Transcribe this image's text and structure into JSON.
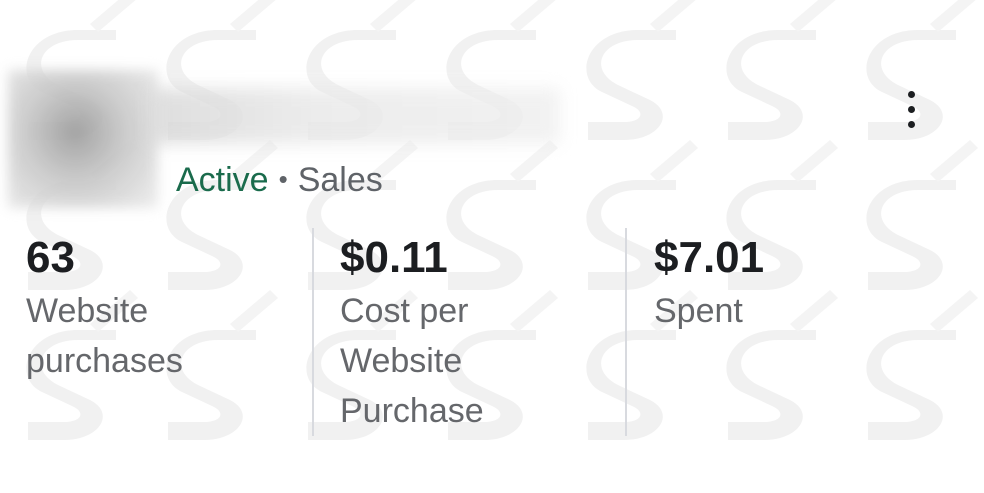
{
  "campaign": {
    "status": "Active",
    "separator": "•",
    "objective": "Sales"
  },
  "more_menu": {
    "icon": "more-vertical-icon"
  },
  "metrics": [
    {
      "value": "63",
      "label_lines": [
        "Website",
        "purchases"
      ]
    },
    {
      "value": "$0.11",
      "label_lines": [
        "Cost per",
        "Website",
        "Purchase"
      ]
    },
    {
      "value": "$7.01",
      "label_lines": [
        "Spent"
      ]
    }
  ],
  "colors": {
    "status_active": "#1a6b4c",
    "text_primary": "#1c1e21",
    "text_secondary": "#65676b",
    "divider": "#d8dadf"
  }
}
